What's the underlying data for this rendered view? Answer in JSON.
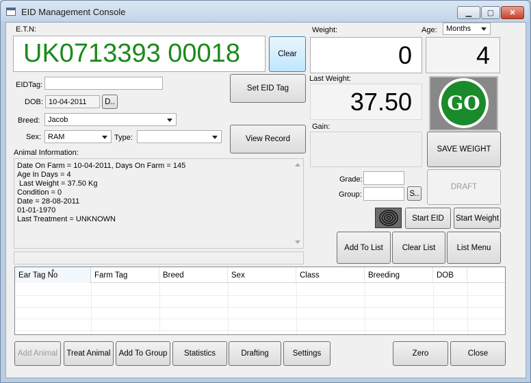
{
  "window": {
    "title": "EID Management Console",
    "minimize_label": "▁",
    "maximize_label": "▢",
    "close_label": "✕"
  },
  "etn": {
    "label": "E.T.N:",
    "value": "UK0713393 00018",
    "value_color": "#1a8a1a",
    "clear_label": "Clear"
  },
  "weight": {
    "label": "Weight:",
    "value": "0"
  },
  "age": {
    "label": "Age:",
    "unit_selected": "Months",
    "value": "4"
  },
  "eidtag": {
    "label": "EIDTag:",
    "value": "",
    "set_label": "Set EID Tag"
  },
  "dob": {
    "label": "DOB:",
    "value": "10-04-2011",
    "picker_label": "D.."
  },
  "breed": {
    "label": "Breed:",
    "value": "Jacob"
  },
  "sex": {
    "label": "Sex:",
    "value": "RAM"
  },
  "type": {
    "label": "Type:",
    "value": ""
  },
  "view_record_label": "View Record",
  "last_weight": {
    "label": "Last Weight:",
    "value": "37.50"
  },
  "gain": {
    "label": "Gain:",
    "value": ""
  },
  "go": {
    "text": "GO",
    "color": "#1a8a2a"
  },
  "save_weight_label": "SAVE WEIGHT",
  "draft_label": "DRAFT",
  "grade": {
    "label": "Grade:",
    "value": ""
  },
  "group": {
    "label": "Group:",
    "value": "",
    "picker_label": "S.."
  },
  "animal_info": {
    "label": "Animal Information:",
    "lines": [
      "Date On Farm = 10-04-2011, Days On Farm = 145",
      "Age In Days = 4",
      " Last Weight = 37.50 Kg",
      "Condition = 0",
      "Date = 28-08-2011",
      "01-01-1970",
      "Last Treatment = UNKNOWN"
    ]
  },
  "actions": {
    "start_eid": "Start EID",
    "start_weight": "Start Weight",
    "add_to_list": "Add To List",
    "clear_list": "Clear List",
    "list_menu": "List Menu"
  },
  "table": {
    "columns": [
      "Ear Tag No",
      "Farm Tag",
      "Breed",
      "Sex",
      "Class",
      "Breeding",
      "DOB"
    ],
    "rows": []
  },
  "bottom": {
    "add_animal": "Add Animal",
    "treat_animal": "Treat Animal",
    "add_to_group": "Add To Group",
    "statistics": "Statistics",
    "drafting": "Drafting",
    "settings": "Settings",
    "zero": "Zero",
    "close": "Close"
  }
}
